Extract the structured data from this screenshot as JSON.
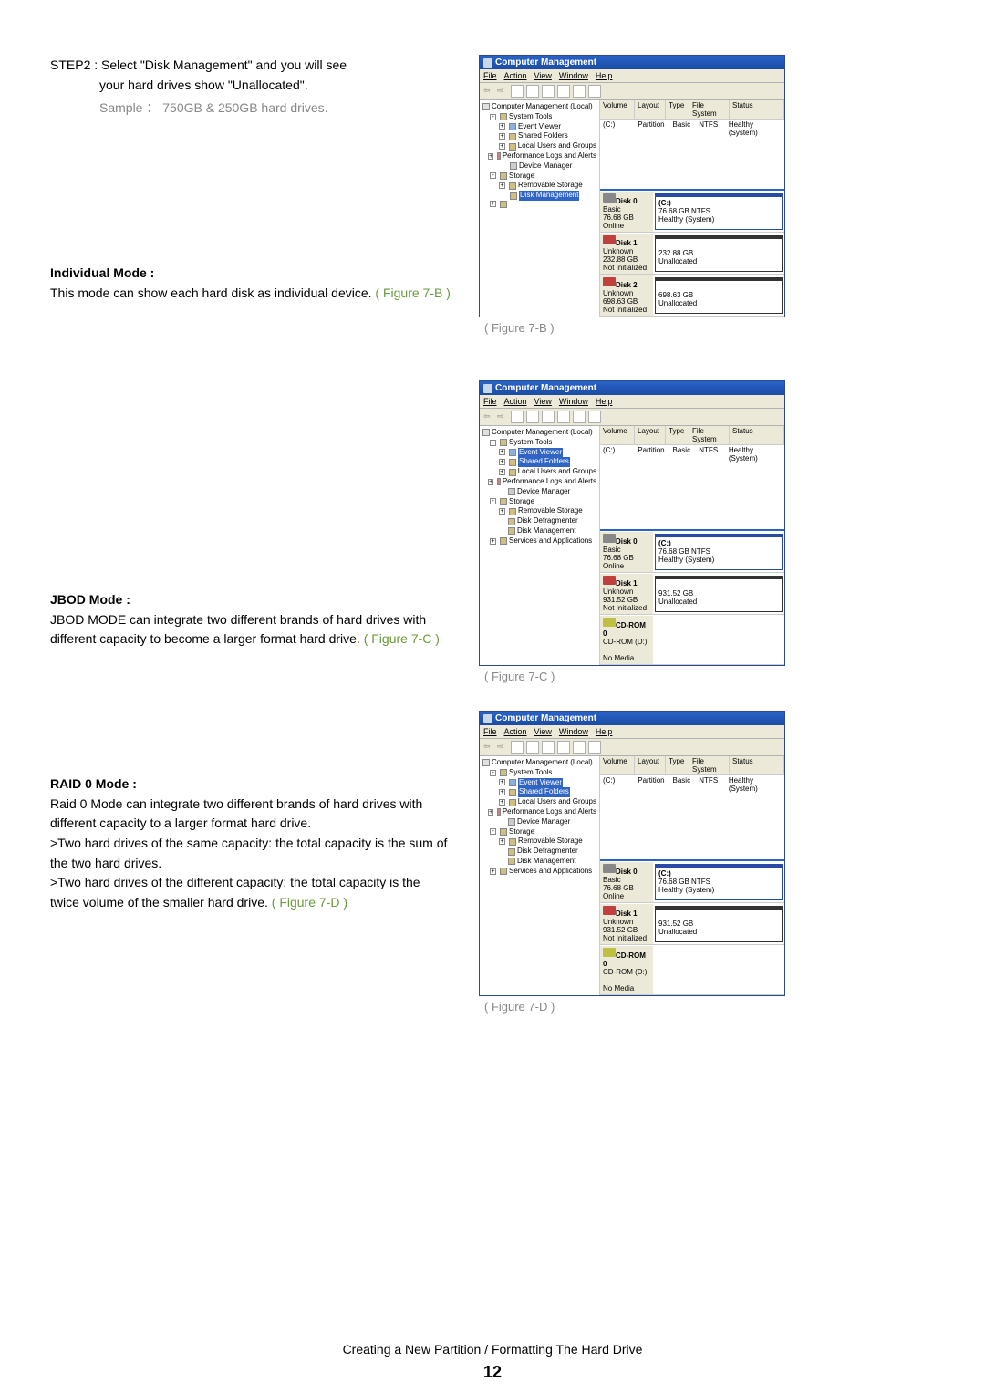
{
  "step2": {
    "line1": "STEP2 : Select \"Disk Management\" and you will see",
    "line2": "your hard drives show \"Unallocated\".",
    "sample": "Sample ： 750GB & 250GB hard drives."
  },
  "individual": {
    "heading": "Individual Mode :",
    "body_a": "This mode can show each hard disk as individual device. ",
    "fig": "( Figure 7-B )"
  },
  "jbod": {
    "heading": "JBOD Mode :",
    "body": "JBOD MODE can integrate two different brands of hard drives with different capacity to become a larger format hard drive. ",
    "fig": "( Figure 7-C )"
  },
  "raid0": {
    "heading": "RAID 0 Mode :",
    "body1": "Raid 0 Mode can integrate two different brands of hard drives with different capacity to a larger format hard drive.",
    "body2": ">Two hard drives of the same capacity: the total capacity is the sum of the two hard drives.",
    "body3": ">Two hard drives of the different capacity: the total capacity is the twice volume of the smaller hard drive.",
    "fig": "( Figure 7-D )"
  },
  "captions": {
    "b": "( Figure 7-B )",
    "c": "( Figure 7-C )",
    "d": "( Figure 7-D )"
  },
  "cm": {
    "title": "Computer Management",
    "menus": {
      "file": "File",
      "action": "Action",
      "view": "View",
      "window": "Window",
      "help": "Help"
    },
    "tree": {
      "root": "Computer Management (Local)",
      "systools": "System Tools",
      "ev": "Event Viewer",
      "sf": "Shared Folders",
      "lug": "Local Users and Groups",
      "pla": "Performance Logs and Alerts",
      "dm": "Device Manager",
      "storage": "Storage",
      "rs": "Removable Storage",
      "ddf": "Disk Defragmenter",
      "dmg": "Disk Management",
      "sa": "Services and Applications"
    },
    "vol_headers": {
      "volume": "Volume",
      "layout": "Layout",
      "type": "Type",
      "fs": "File System",
      "status": "Status"
    },
    "vol_row": {
      "name": "(C:)",
      "layout": "Partition",
      "type": "Basic",
      "fs": "NTFS",
      "status": "Healthy (System)"
    },
    "disks_b": {
      "d0": {
        "title": "Disk 0",
        "l1": "Basic",
        "l2": "76.68 GB",
        "l3": "Online",
        "r1": "(C:)",
        "r2": "76.68 GB NTFS",
        "r3": "Healthy (System)"
      },
      "d1": {
        "title": "Disk 1",
        "l1": "Unknown",
        "l2": "232.88 GB",
        "l3": "Not Initialized",
        "r1": "",
        "r2": "232.88 GB",
        "r3": "Unallocated"
      },
      "d2": {
        "title": "Disk 2",
        "l1": "Unknown",
        "l2": "698.63 GB",
        "l3": "Not Initialized",
        "r1": "",
        "r2": "698.63 GB",
        "r3": "Unallocated"
      }
    },
    "disks_c": {
      "d0": {
        "title": "Disk 0",
        "l1": "Basic",
        "l2": "76.68 GB",
        "l3": "Online",
        "r1": "(C:)",
        "r2": "76.68 GB NTFS",
        "r3": "Healthy (System)"
      },
      "d1": {
        "title": "Disk 1",
        "l1": "Unknown",
        "l2": "931.52 GB",
        "l3": "Not Initialized",
        "r1": "",
        "r2": "931.52 GB",
        "r3": "Unallocated"
      },
      "cd": {
        "title": "CD-ROM 0",
        "l1": "CD-ROM (D:)",
        "l2": "",
        "l3": "No Media"
      }
    },
    "disks_d": {
      "d0": {
        "title": "Disk 0",
        "l1": "Basic",
        "l2": "76.68 GB",
        "l3": "Online",
        "r1": "(C:)",
        "r2": "76.68 GB NTFS",
        "r3": "Healthy (System)"
      },
      "d1": {
        "title": "Disk 1",
        "l1": "Unknown",
        "l2": "931.52 GB",
        "l3": "Not Initialized",
        "r1": "",
        "r2": "931.52 GB",
        "r3": "Unallocated"
      },
      "cd": {
        "title": "CD-ROM 0",
        "l1": "CD-ROM (D:)",
        "l2": "",
        "l3": "No Media"
      }
    }
  },
  "footer": "Creating a New Partition / Formatting The Hard Drive",
  "page": "12"
}
